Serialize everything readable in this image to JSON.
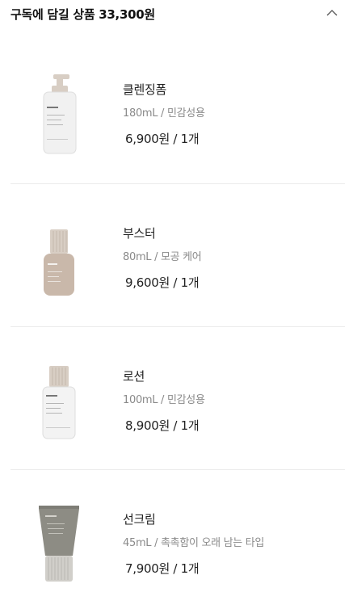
{
  "header": {
    "title": "구독에 담길 상품 33,300원",
    "collapse_icon": "chevron-up-icon"
  },
  "products": [
    {
      "name": "클렌징폼",
      "spec": "180mL / 민감성용",
      "price": "6,900원  / 1개",
      "image": "cleansing-foam-pump-bottle"
    },
    {
      "name": "부스터",
      "spec": "80mL / 모공 케어",
      "price": "9,600원  / 1개",
      "image": "booster-bottle"
    },
    {
      "name": "로션",
      "spec": "100mL / 민감성용",
      "price": "8,900원  / 1개",
      "image": "lotion-bottle"
    },
    {
      "name": "선크림",
      "spec": "45mL / 촉촉함이 오래 남는 타입",
      "price": "7,900원  / 1개",
      "image": "sunscreen-tube"
    }
  ],
  "colors": {
    "text": "#222222",
    "subtext": "#8a8a8a",
    "divider": "#ebebeb",
    "cap_beige": "#d8cec4",
    "booster_body": "#c9b8aa",
    "sunscreen_body": "#8d8c84"
  }
}
